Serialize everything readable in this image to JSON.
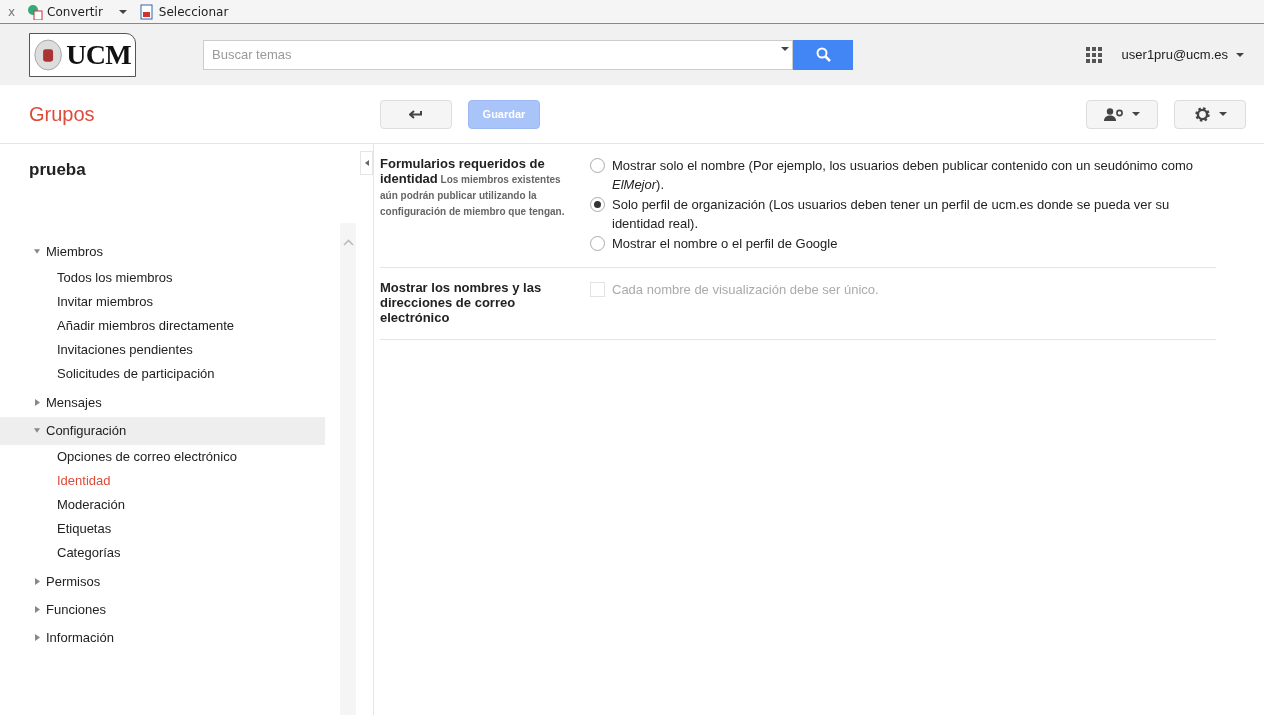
{
  "browser_toolbar": {
    "close": "x",
    "items": [
      {
        "label": "Convertir",
        "kind": "convert",
        "has_menu": true
      },
      {
        "label": "Seleccionar",
        "kind": "select",
        "has_menu": false
      }
    ]
  },
  "header": {
    "logo": "UCM",
    "search": {
      "placeholder": "Buscar temas"
    },
    "user": "user1pru@ucm.es"
  },
  "app_title": "Grupos",
  "actions": {
    "save": {
      "label": "Guardar",
      "disabled": true
    }
  },
  "group_name": "prueba",
  "nav": [
    {
      "label": "Miembros",
      "expanded": true,
      "selected": false,
      "children": [
        {
          "label": "Todos los miembros",
          "selected": false
        },
        {
          "label": "Invitar miembros",
          "selected": false
        },
        {
          "label": "Añadir miembros directamente",
          "selected": false
        },
        {
          "label": "Invitaciones pendientes",
          "selected": false
        },
        {
          "label": "Solicitudes de participación",
          "selected": false
        }
      ]
    },
    {
      "label": "Mensajes",
      "expanded": false,
      "selected": false
    },
    {
      "label": "Configuración",
      "expanded": true,
      "selected": true,
      "children": [
        {
          "label": "Opciones de correo electrónico",
          "selected": false
        },
        {
          "label": "Identidad",
          "selected": true
        },
        {
          "label": "Moderación",
          "selected": false
        },
        {
          "label": "Etiquetas",
          "selected": false
        },
        {
          "label": "Categorías",
          "selected": false
        }
      ]
    },
    {
      "label": "Permisos",
      "expanded": false,
      "selected": false
    },
    {
      "label": "Funciones",
      "expanded": false,
      "selected": false
    },
    {
      "label": "Información",
      "expanded": false,
      "selected": false
    }
  ],
  "settings": [
    {
      "title": "Formularios requeridos de identidad",
      "description": "Los miembros existentes aún podrán publicar utilizando la configuración de miembro que tengan.",
      "kind": "radio",
      "options": [
        {
          "label": "Mostrar solo el nombre  (Por ejemplo, los usuarios deben publicar contenido con un seudónimo como *ElMejor*).",
          "selected": false
        },
        {
          "label": "Solo perfil de organización (Los usuarios deben tener un perfil de ucm.es donde se pueda ver su identidad real).",
          "selected": true
        },
        {
          "label": "Mostrar el nombre o el perfil de Google",
          "selected": false
        }
      ]
    },
    {
      "title": "Mostrar los nombres y las direcciones de correo electrónico",
      "kind": "checkbox",
      "options": [
        {
          "label": "Cada nombre de visualización debe ser único.",
          "checked": false,
          "disabled": true
        }
      ]
    }
  ]
}
